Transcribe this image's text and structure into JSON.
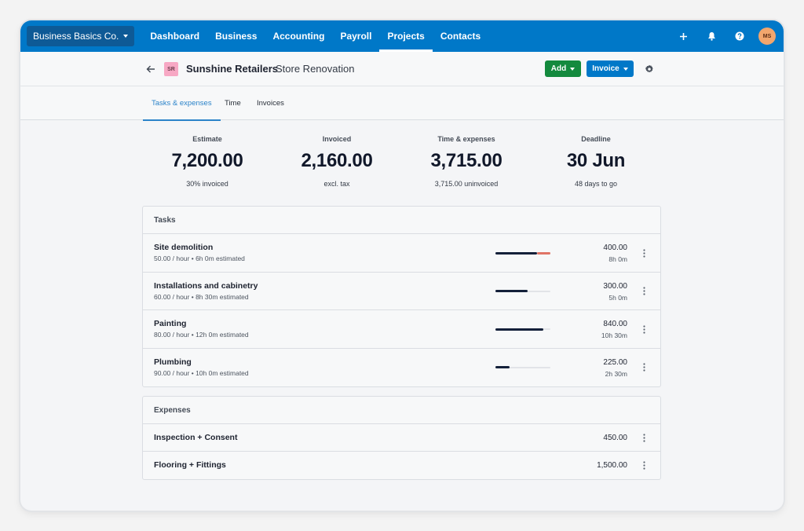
{
  "topnav": {
    "org": "Business Basics Co.",
    "items": [
      {
        "label": "Dashboard",
        "active": false
      },
      {
        "label": "Business",
        "active": false
      },
      {
        "label": "Accounting",
        "active": false
      },
      {
        "label": "Payroll",
        "active": false
      },
      {
        "label": "Projects",
        "active": true
      },
      {
        "label": "Contacts",
        "active": false
      }
    ],
    "icons": [
      "plus-icon",
      "bell-icon",
      "help-icon"
    ],
    "avatar_initials": "MS",
    "brand_color": "#0078c8"
  },
  "header": {
    "client_initials": "SR",
    "client_name": "Sunshine Retailers",
    "project_name": "Store Renovation",
    "add_label": "Add",
    "invoice_label": "Invoice"
  },
  "tabs": [
    {
      "label": "Tasks & expenses",
      "active": true
    },
    {
      "label": "Time",
      "active": false
    },
    {
      "label": "Invoices",
      "active": false
    }
  ],
  "summary": [
    {
      "label": "Estimate",
      "value": "7,200.00",
      "sub": "30% invoiced"
    },
    {
      "label": "Invoiced",
      "value": "2,160.00",
      "sub": "excl. tax"
    },
    {
      "label": "Time & expenses",
      "value": "3,715.00",
      "sub": "3,715.00 uninvoiced"
    },
    {
      "label": "Deadline",
      "value": "30 Jun",
      "sub": "48 days to go"
    }
  ],
  "tasks": {
    "title": "Tasks",
    "rows": [
      {
        "name": "Site demolition",
        "meta": "50.00 / hour • 6h 0m estimated",
        "amount": "400.00",
        "hours": "8h 0m",
        "progress": 0.75,
        "overrun": 0.25
      },
      {
        "name": "Installations and cabinetry",
        "meta": "60.00 / hour • 8h 30m estimated",
        "amount": "300.00",
        "hours": "5h 0m",
        "progress": 0.59,
        "overrun": 0
      },
      {
        "name": "Painting",
        "meta": "80.00 / hour • 12h 0m estimated",
        "amount": "840.00",
        "hours": "10h 30m",
        "progress": 0.875,
        "overrun": 0
      },
      {
        "name": "Plumbing",
        "meta": "90.00 / hour • 10h 0m estimated",
        "amount": "225.00",
        "hours": "2h 30m",
        "progress": 0.25,
        "overrun": 0
      }
    ]
  },
  "expenses": {
    "title": "Expenses",
    "rows": [
      {
        "name": "Inspection + Consent",
        "amount": "450.00"
      },
      {
        "name": "Flooring + Fittings",
        "amount": "1,500.00"
      }
    ]
  }
}
